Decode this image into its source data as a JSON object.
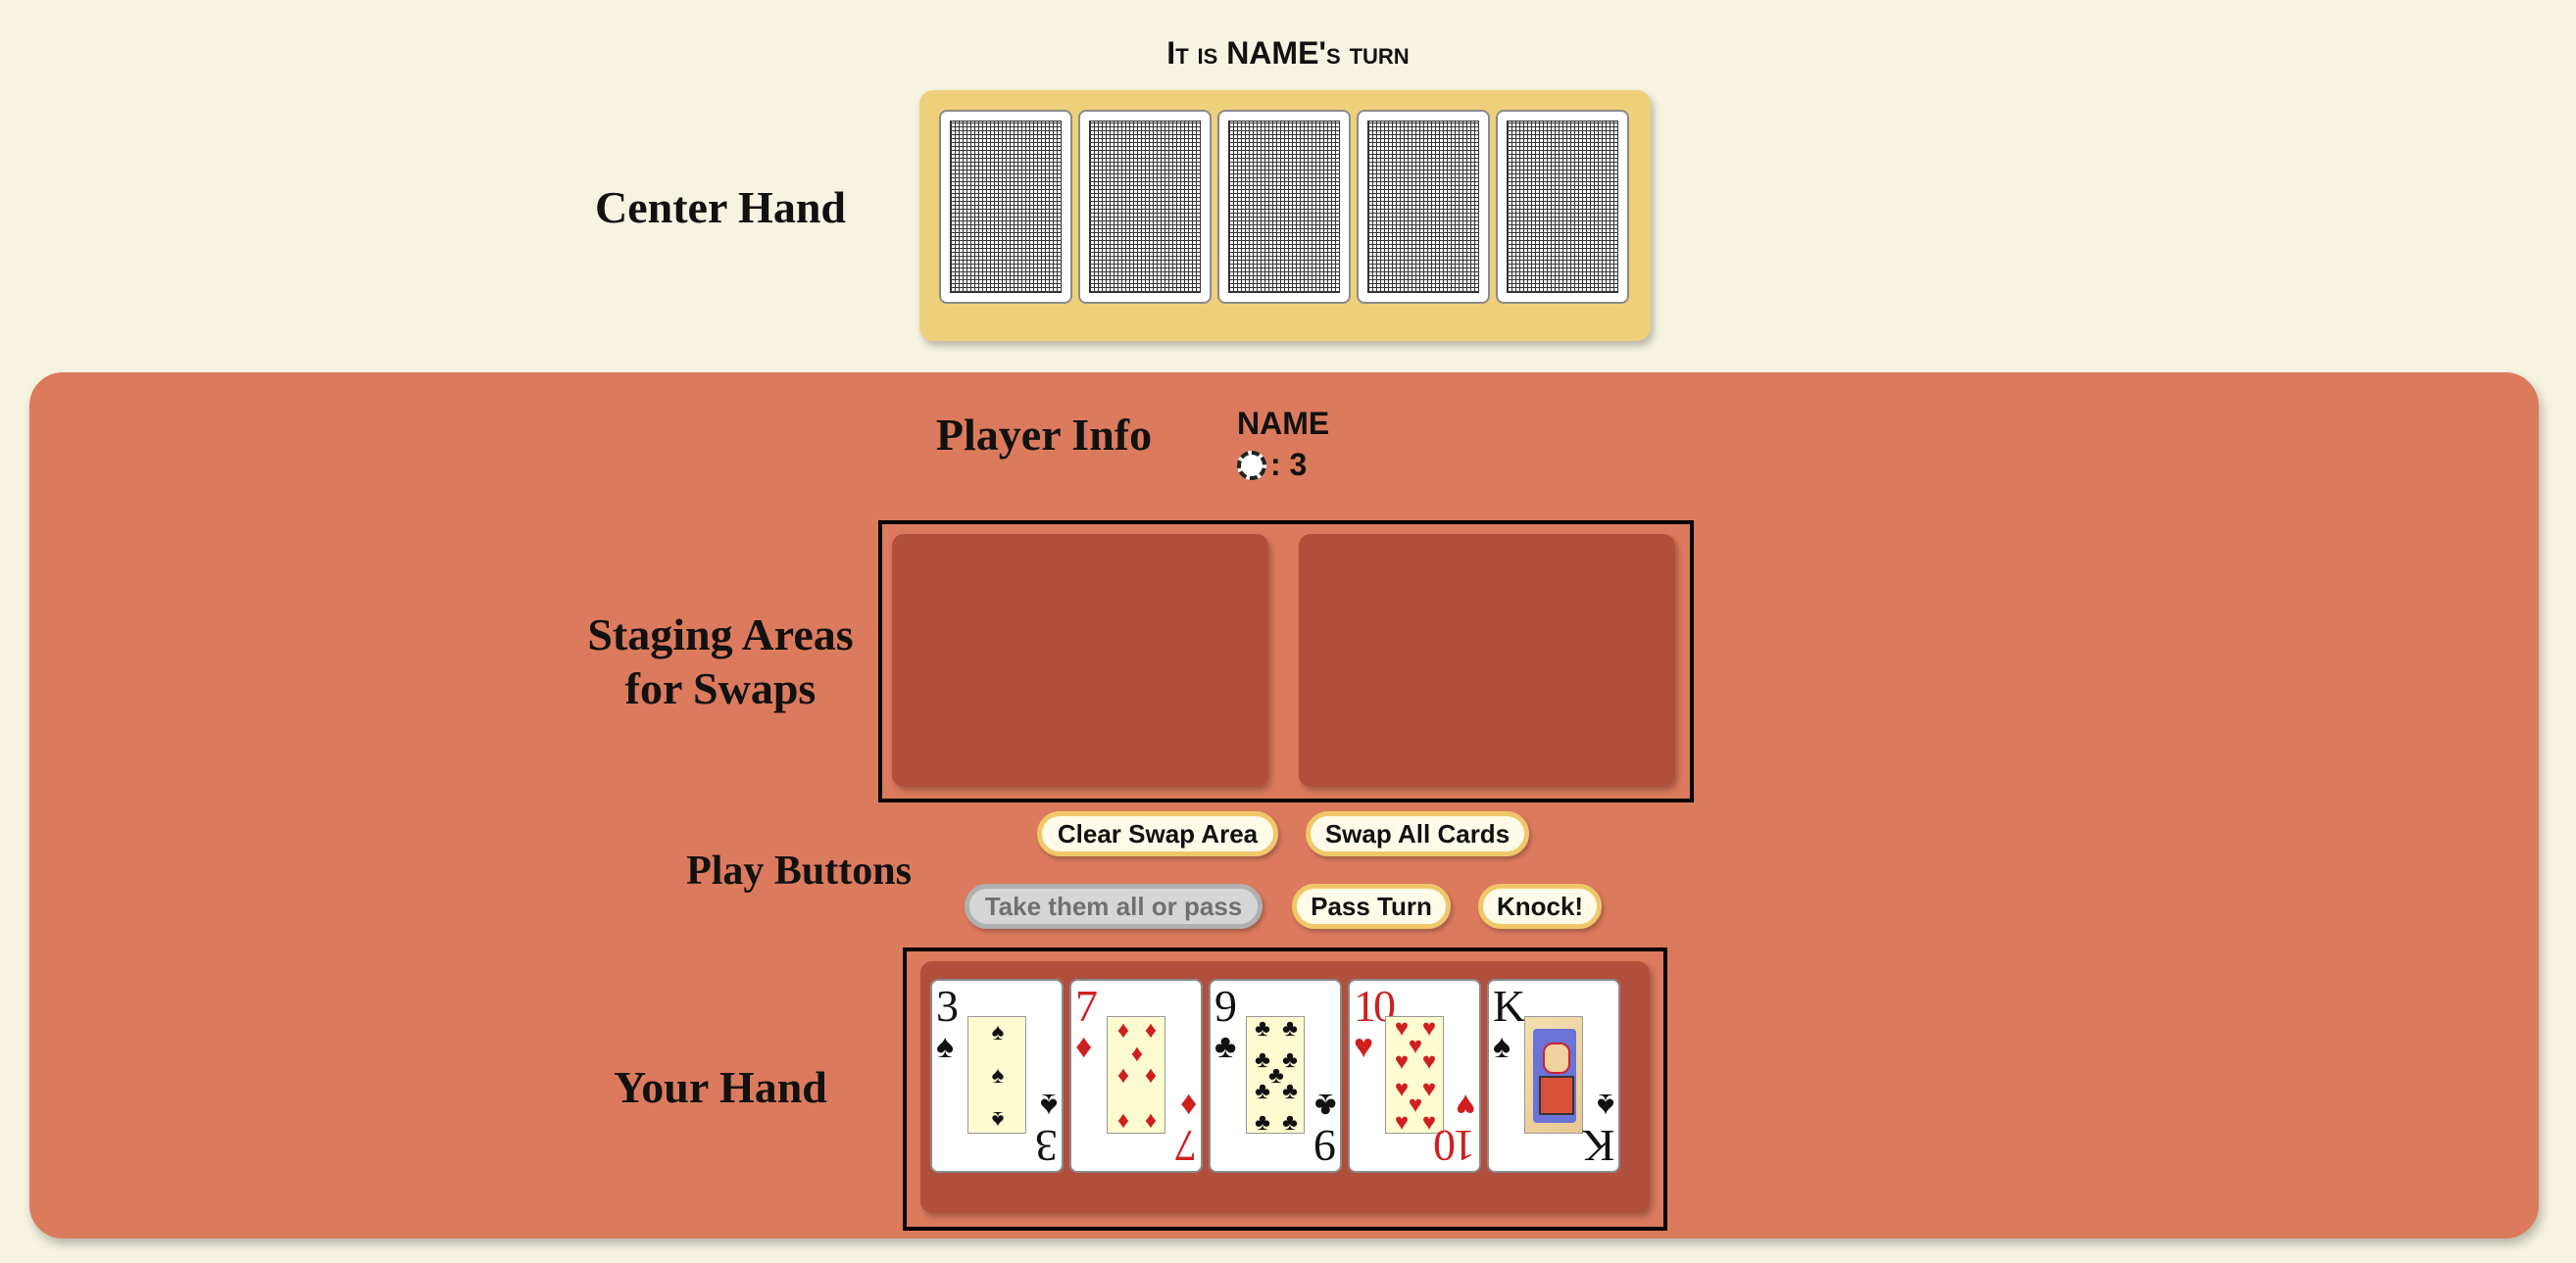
{
  "header": {
    "turn_text": "It is NAME's turn"
  },
  "labels": {
    "center_hand": "Center Hand",
    "player_info": "Player Info",
    "staging_line1": "Staging Areas",
    "staging_line2": "for Swaps",
    "play_buttons": "Play Buttons",
    "your_hand": "Your Hand"
  },
  "player": {
    "name": "NAME",
    "chips": ": 3",
    "chip_icon": "chip-icon"
  },
  "buttons": {
    "clear_swap": "Clear Swap Area",
    "swap_all": "Swap All Cards",
    "take_all": "Take them all or pass",
    "pass_turn": "Pass Turn",
    "knock": "Knock!"
  },
  "center_hand": {
    "card_count": 5,
    "face": "down"
  },
  "your_hand": [
    {
      "rank": "3",
      "suit": "♠",
      "suit_name": "spades",
      "color": "black"
    },
    {
      "rank": "7",
      "suit": "♦",
      "suit_name": "diamonds",
      "color": "red"
    },
    {
      "rank": "9",
      "suit": "♣",
      "suit_name": "clubs",
      "color": "black"
    },
    {
      "rank": "10",
      "suit": "♥",
      "suit_name": "hearts",
      "color": "red"
    },
    {
      "rank": "K",
      "suit": "♠",
      "suit_name": "spades",
      "color": "black"
    }
  ],
  "colors": {
    "background": "#f6f3e1",
    "center_tray": "#efd07a",
    "panel": "#dc7a5d",
    "staging_area": "#b14f3d",
    "button_border": "#f0c86a",
    "red_suit": "#d01f1f"
  }
}
